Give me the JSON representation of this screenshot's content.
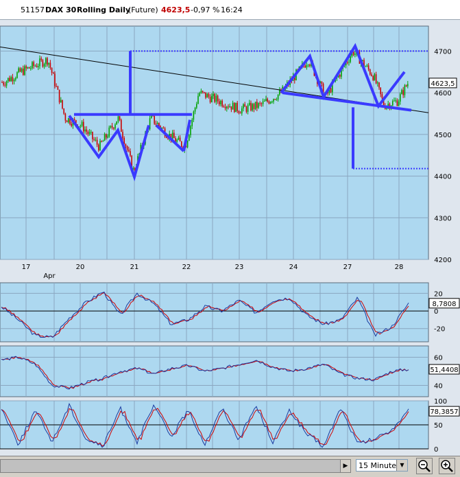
{
  "header": {
    "code": "51157",
    "name": "DAX 30",
    "contract": "Rolling Daily",
    "type": "(Future)",
    "last": "4623,5",
    "change": "-0,97 %",
    "time": "16:24"
  },
  "colors": {
    "plot_bg": "#add8f0",
    "candle_up": "#00a000",
    "candle_down": "#c80000",
    "pattern": "#3a3aff",
    "price_label": "#c00000",
    "osc_blue": "#1a3aa0",
    "osc_red": "#d00000"
  },
  "chart_data": [
    {
      "type": "candlestick",
      "panel": "price",
      "x_ticks": [
        "17",
        "20",
        "21",
        "22",
        "23",
        "24",
        "27",
        "28"
      ],
      "x_sub_label": "Apr",
      "y_ticks": [
        4200,
        4300,
        4400,
        4500,
        4600,
        4700
      ],
      "ylim": [
        4200,
        4760
      ],
      "last_value_label": "4623,5",
      "series": [
        {
          "name": "",
          "x": [
            "17",
            "20",
            "21",
            "22",
            "23",
            "24",
            "27",
            "28"
          ],
          "values": [
            4670,
            4530,
            4450,
            4590,
            4560,
            4640,
            4680,
            4623.5
          ]
        }
      ],
      "annotations": {
        "trendline_from": 4710,
        "trendline_to": 4552,
        "target_up": 4700,
        "target_down": 4418,
        "neckline_left": 4548,
        "neckline_right": 4558
      }
    },
    {
      "type": "line",
      "panel": "oscillator-1",
      "y_ticks": [
        20,
        0,
        -20
      ],
      "ylim": [
        -35,
        32
      ],
      "last_value_label": "8,7808",
      "series": [
        {
          "name": "",
          "values": [
            5,
            -10,
            -28,
            -30,
            -8,
            10,
            22,
            -5,
            20,
            8,
            -15,
            -10,
            5,
            0,
            12,
            -2,
            12,
            15,
            -5,
            -15,
            -10,
            15,
            -28,
            -18,
            8.78
          ]
        }
      ]
    },
    {
      "type": "line",
      "panel": "oscillator-2",
      "y_ticks": [
        60,
        40
      ],
      "ylim": [
        32,
        68
      ],
      "last_value_label": "51,4408",
      "series": [
        {
          "name": "",
          "values": [
            58,
            60,
            55,
            40,
            38,
            42,
            45,
            50,
            52,
            48,
            52,
            54,
            50,
            52,
            55,
            58,
            53,
            50,
            52,
            55,
            48,
            45,
            44,
            50,
            51.44
          ]
        }
      ]
    },
    {
      "type": "line",
      "panel": "stochastic",
      "y_ticks": [
        100,
        50,
        0
      ],
      "ylim": [
        0,
        100
      ],
      "last_value_label": "78,3857",
      "series": [
        {
          "name": "",
          "values": [
            85,
            10,
            80,
            15,
            90,
            20,
            5,
            85,
            15,
            90,
            25,
            80,
            10,
            85,
            20,
            90,
            15,
            80,
            30,
            5,
            85,
            10,
            20,
            40,
            78.39
          ]
        }
      ]
    }
  ],
  "footer": {
    "timeframe": "15 Minutes",
    "zoom_out": "zoom-out-icon",
    "zoom_in": "zoom-in-icon"
  }
}
